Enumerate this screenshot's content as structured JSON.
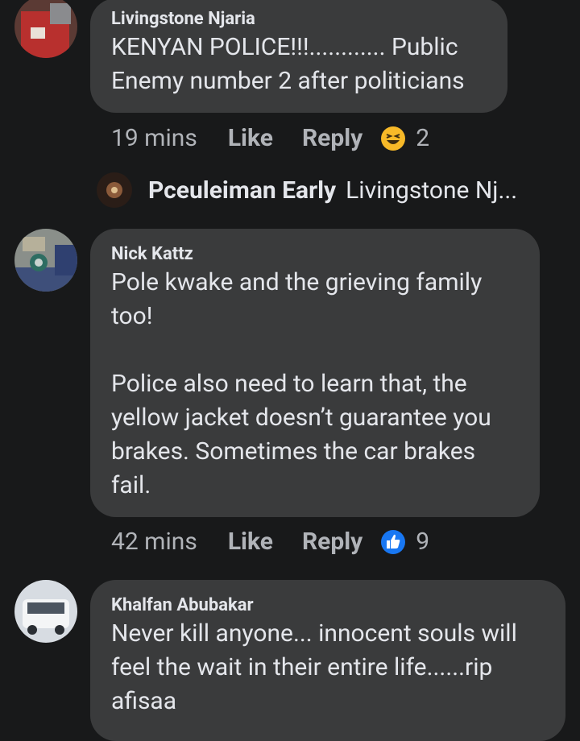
{
  "comments": [
    {
      "author": "Livingstone Njaria",
      "text": "KENYAN POLICE!!!............ Public\nEnemy number 2 after politicians",
      "time": "19 mins",
      "like": "Like",
      "reply": "Reply",
      "reaction_icon": "laughing-emoji-icon",
      "reaction_count": "2"
    },
    {
      "author": "Nick Kattz",
      "text": "Pole kwake and the grieving family\ntoo!\n\nPolice also need to learn that, the\nyellow jacket doesn’t guarantee you\nbrakes. Sometimes the car brakes\nfail.",
      "time": "42 mins",
      "like": "Like",
      "reply": "Reply",
      "reaction_icon": "thumbs-up-icon",
      "reaction_count": "9"
    },
    {
      "author": "Khalfan Abubakar",
      "text": "Never kill anyone... innocent souls will\nfeel the wait in their entire life......rip\nafisaa"
    }
  ],
  "reply_preview": {
    "name": "Pceuleiman Early",
    "text": "Livingstone Nj..."
  },
  "colors": {
    "background": "#18191a",
    "bubble": "#3a3b3c",
    "secondary_text": "#b0b3b8",
    "like_blue": "#1877f2",
    "laugh_yellow": "#f7b928"
  }
}
